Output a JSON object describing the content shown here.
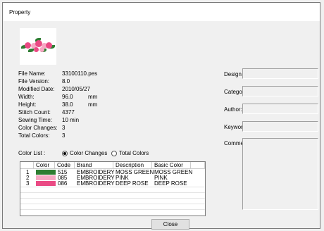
{
  "window": {
    "title": "Property"
  },
  "info": {
    "file_name_label": "File Name:",
    "file_name": "33100110.pes",
    "file_version_label": "File Version:",
    "file_version": "8.0",
    "modified_date_label": "Modified Date:",
    "modified_date": "2010/05/27",
    "width_label": "Width:",
    "width": "96.0",
    "width_unit": "mm",
    "height_label": "Height:",
    "height": "38.0",
    "height_unit": "mm",
    "stitch_count_label": "Stitch Count:",
    "stitch_count": "4377",
    "sewing_time_label": "Sewing Time:",
    "sewing_time": "10  min",
    "color_changes_label": "Color Changes:",
    "color_changes": "3",
    "total_colors_label": "Total Colors:",
    "total_colors": "3"
  },
  "color_list": {
    "label": "Color List :",
    "option_changes": "Color Changes",
    "option_total": "Total Colors",
    "selected": "Color Changes"
  },
  "table": {
    "headers": [
      "Color",
      "Code",
      "Brand",
      "Description",
      "Basic Color"
    ],
    "rows": [
      {
        "num": "1",
        "color": "#2e7d32",
        "code": "515",
        "brand": "EMBROIDERY",
        "description": "MOSS GREEN",
        "basic": "MOSS GREEN"
      },
      {
        "num": "2",
        "color": "#f7a8c4",
        "code": "085",
        "brand": "EMBROIDERY",
        "description": "PINK",
        "basic": "PINK"
      },
      {
        "num": "3",
        "color": "#ea4a84",
        "code": "086",
        "brand": "EMBROIDERY",
        "description": "DEEP ROSE",
        "basic": "DEEP ROSE"
      }
    ]
  },
  "fields": {
    "design_name_label": "Design Name:",
    "category_label": "Category:",
    "author_label": "Author:",
    "keywords_label": "Keywords:",
    "comment_label": "Comment:"
  },
  "buttons": {
    "close": "Close"
  }
}
